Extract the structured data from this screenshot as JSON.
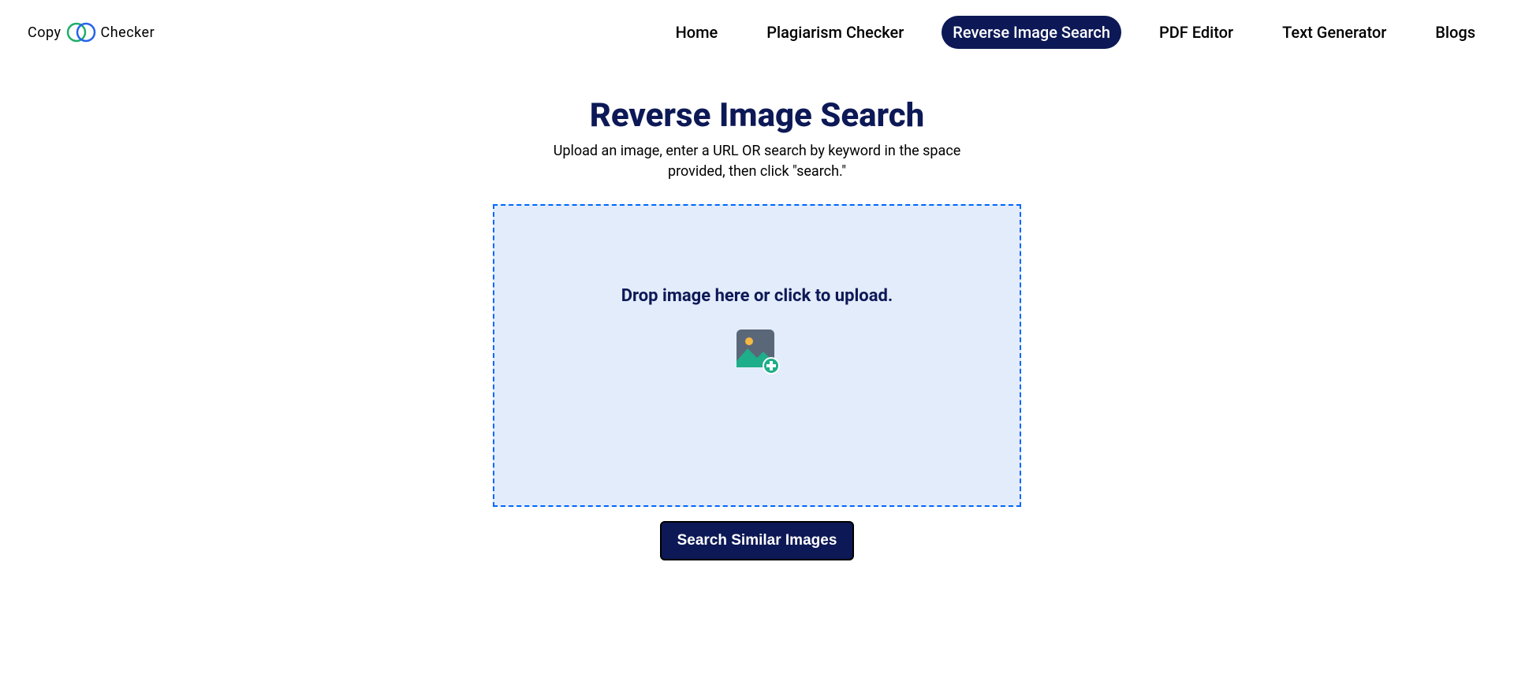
{
  "logo": {
    "text_left": "Copy",
    "text_right": "Checker"
  },
  "nav": {
    "items": [
      {
        "label": "Home",
        "active": false
      },
      {
        "label": "Plagiarism Checker",
        "active": false
      },
      {
        "label": "Reverse Image Search",
        "active": true
      },
      {
        "label": "PDF Editor",
        "active": false
      },
      {
        "label": "Text Generator",
        "active": false
      },
      {
        "label": "Blogs",
        "active": false
      }
    ]
  },
  "main": {
    "title": "Reverse Image Search",
    "subtitle": "Upload an image, enter a URL OR search by keyword in the space provided, then click \"search.\"",
    "dropzone_text": "Drop image here or click to upload.",
    "search_button": "Search Similar Images"
  },
  "colors": {
    "brand_dark": "#0d1956",
    "dropzone_bg": "#e3ecfb",
    "dropzone_border": "#0066ff",
    "logo_green": "#1eae6a",
    "logo_blue": "#2563eb"
  }
}
